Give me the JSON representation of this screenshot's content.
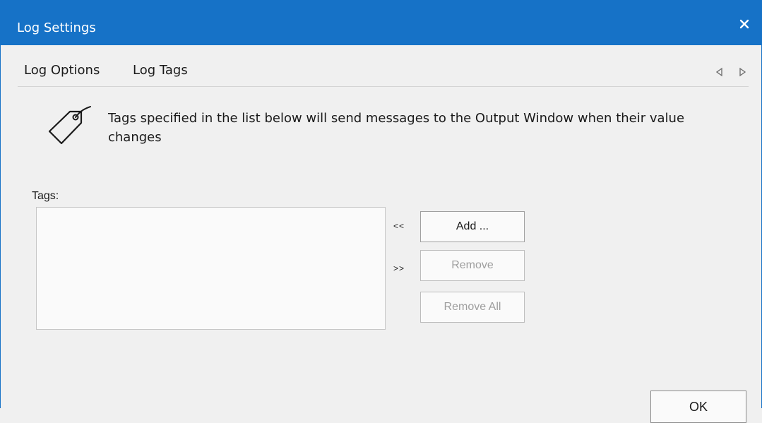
{
  "window": {
    "title": "Log Settings",
    "accent_color": "#1672c7"
  },
  "tabs": [
    {
      "label": "Log Options",
      "active": false
    },
    {
      "label": "Log Tags",
      "active": true
    }
  ],
  "tab_nav": {
    "prev_icon": "triangle-left-icon",
    "next_icon": "triangle-right-icon"
  },
  "info": {
    "icon": "tag-icon",
    "text": "Tags specified in the list below will send messages to the Output Window when their value changes"
  },
  "tags_section": {
    "label": "Tags:",
    "items": [],
    "add_arrow": "<<",
    "remove_arrow": ">>",
    "add_label": "Add ...",
    "remove_label": "Remove",
    "remove_all_label": "Remove All"
  },
  "footer": {
    "ok_label": "OK"
  }
}
